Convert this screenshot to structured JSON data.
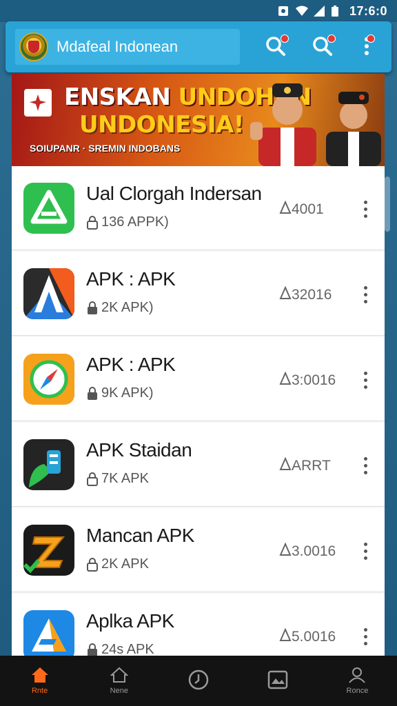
{
  "status_bar": {
    "time": "17:6:0",
    "icons": [
      "notification-icon",
      "wifi-icon",
      "signal-icon",
      "battery-icon"
    ]
  },
  "app_bar": {
    "title": "Mdafeal Indonean",
    "logo": "garuda-emblem-logo",
    "actions": [
      {
        "icon": "search-icon",
        "badge": "red-dot"
      },
      {
        "icon": "search-icon",
        "badge": "red-dot"
      },
      {
        "icon": "more-vert-icon",
        "badge": "red-dot"
      }
    ]
  },
  "banner": {
    "line1_white": "ENSKAN ",
    "line1_yellow": "UNDOHAN",
    "line2": "UNDONESIA!",
    "line3": "SOIUPANR · SREMIN  INDOBANS",
    "colors": {
      "primary": "#d85a14",
      "accent": "#ffcc1a",
      "red": "#a31717"
    }
  },
  "apps": [
    {
      "name": "Ual Clorgah Indersan",
      "meta": "136 APPK)",
      "version": "4001",
      "icon": "green-triangle-icon"
    },
    {
      "name": "APK : APK",
      "meta": "2K APK)",
      "version": "32016",
      "icon": "orange-a-icon"
    },
    {
      "name": "APK : APK",
      "meta": "9K APK)",
      "version": "3:0016",
      "icon": "compass-icon"
    },
    {
      "name": "APK Staidan",
      "meta": "7K APK",
      "version": "ARRT",
      "icon": "green-plug-icon"
    },
    {
      "name": "Mancan APK",
      "meta": "2K APK",
      "version": "3.0016",
      "icon": "z-logo-icon"
    },
    {
      "name": "Aplka APK",
      "meta": "24s APK",
      "version": "5.0016",
      "icon": "blue-triangle-icon"
    }
  ],
  "bottom_nav": [
    {
      "label": "Rnte",
      "icon": "home-icon",
      "active": true
    },
    {
      "label": "Nene",
      "icon": "home-outline-icon",
      "active": false
    },
    {
      "label": "",
      "icon": "clock-icon",
      "active": false
    },
    {
      "label": "",
      "icon": "image-icon",
      "active": false
    },
    {
      "label": "Ronce",
      "icon": "person-icon",
      "active": false
    }
  ],
  "colors": {
    "app_bar": "#29a3d6",
    "status_bar": "#1e5d82",
    "nav_active": "#ff6a1a"
  }
}
